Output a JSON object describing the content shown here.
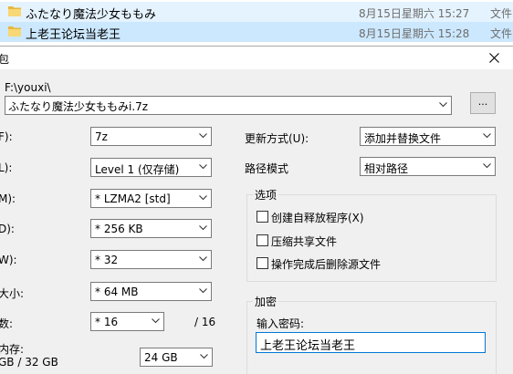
{
  "explorer": {
    "rows": [
      {
        "name": "ふたなり魔法少女ももみ",
        "date": "8月15日星期六 15:27",
        "type": "文件"
      },
      {
        "name": "上老王论坛当老王",
        "date": "8月15日星期六 15:28",
        "type": "文件"
      }
    ]
  },
  "dialog": {
    "title": "包",
    "archive_path_label": "F:\\youxi\\",
    "archive_name": "ふたなり魔法少女ももみi.7z",
    "browse_label": "...",
    "left_labels": {
      "format": "F):",
      "level": "L):",
      "method": "M):",
      "dict": "D):",
      "word": "W):",
      "solid": "大小:",
      "threads": "数:",
      "memory_title": "内存:",
      "memory_value": "GB / 32 GB"
    },
    "format_value": "7z",
    "level_value": "Level 1 (仅存储)",
    "method_value": "* LZMA2 [std]",
    "dict_value": "* 256 KB",
    "word_value": "* 32",
    "solid_value": "* 64 MB",
    "threads_value": "* 16",
    "threads_max": "/ 16",
    "memory_combo_value": "24 GB",
    "update_mode_label": "更新方式(U):",
    "update_mode_value": "添加并替换文件",
    "path_mode_label": "路径模式",
    "path_mode_value": "相对路径",
    "options": {
      "title": "选项",
      "sfx": "创建自释放程序(X)",
      "shared": "压缩共享文件",
      "delete_after": "操作完成后删除源文件"
    },
    "encryption": {
      "title": "加密",
      "password_label": "输入密码:",
      "password_value": "上老王论坛当老王"
    }
  }
}
